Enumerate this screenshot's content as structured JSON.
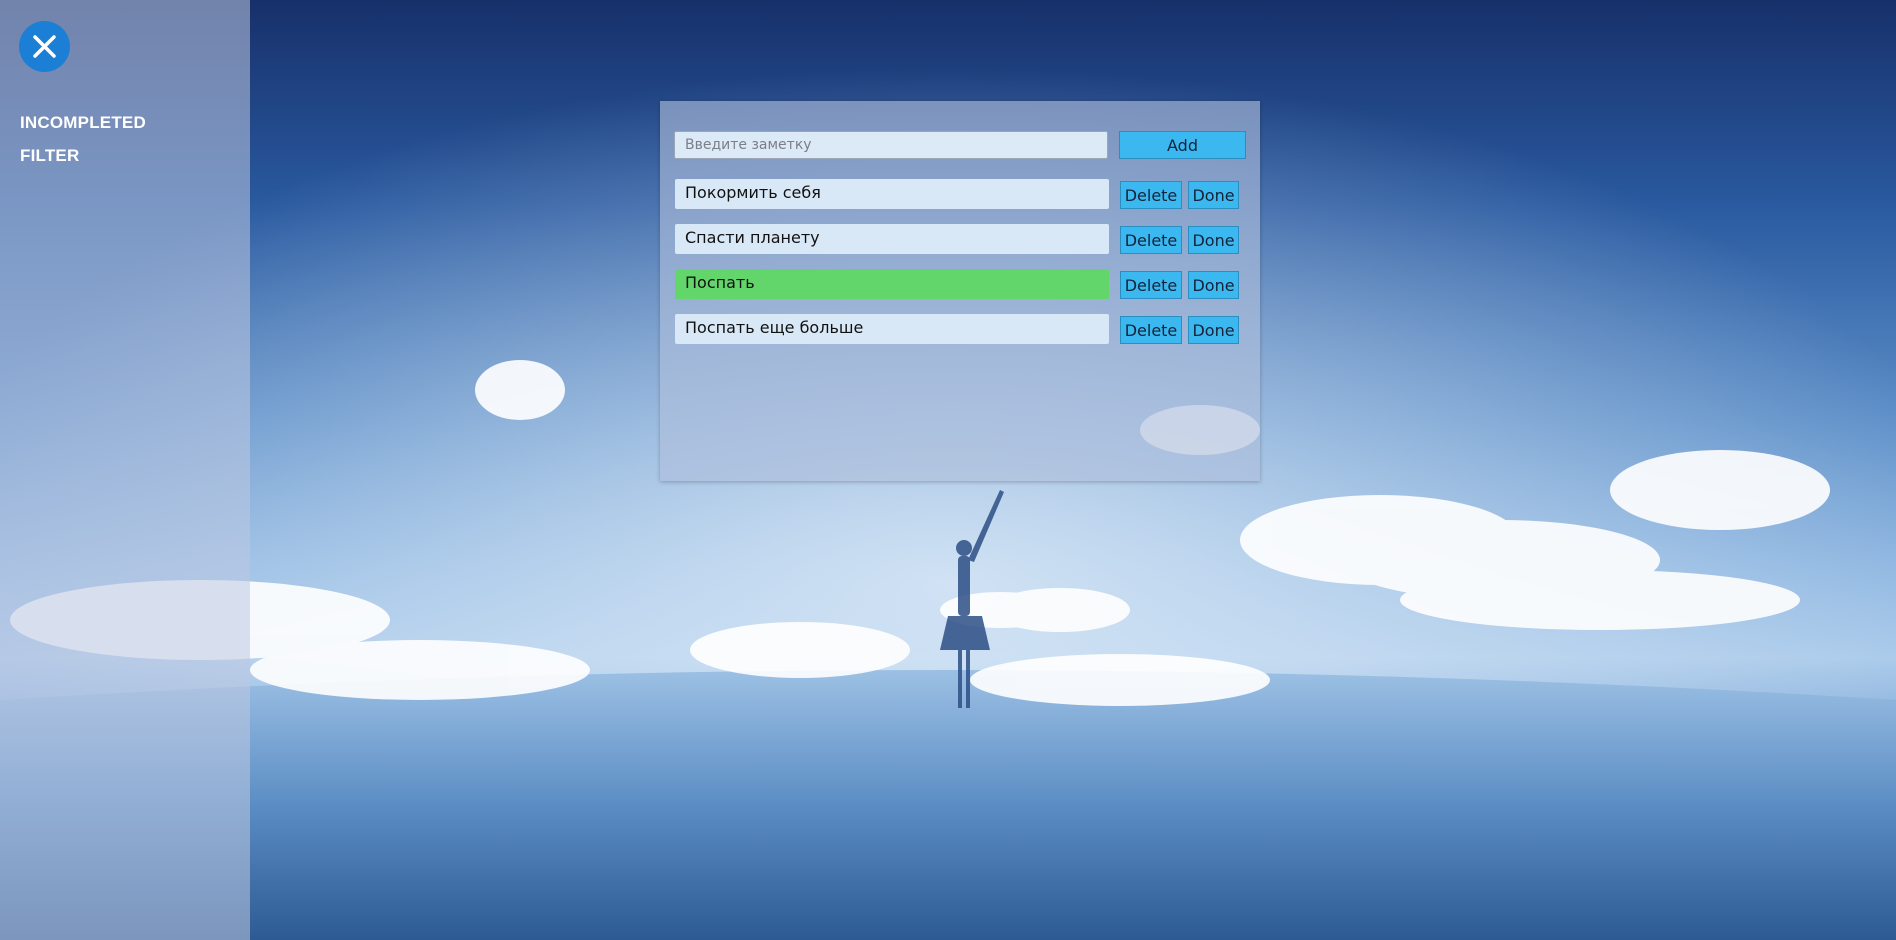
{
  "sidebar": {
    "nav": [
      "INCOMPLETED",
      "FILTER"
    ]
  },
  "form": {
    "placeholder": "Введите заметку",
    "add_label": "Add"
  },
  "tasks": [
    {
      "text": "Покормить себя",
      "completed": false,
      "delete_label": "Delete",
      "done_label": "Done"
    },
    {
      "text": "Спасти планету",
      "completed": false,
      "delete_label": "Delete",
      "done_label": "Done"
    },
    {
      "text": "Поспать",
      "completed": true,
      "delete_label": "Delete",
      "done_label": "Done"
    },
    {
      "text": "Поспать еще больше",
      "completed": false,
      "delete_label": "Delete",
      "done_label": "Done"
    }
  ],
  "colors": {
    "accent": "#3ab8ef",
    "close_button": "#1b7fd6",
    "completed": "#62d66a",
    "task_background": "#d9e8f7"
  },
  "icons": {
    "close": "close-icon"
  }
}
